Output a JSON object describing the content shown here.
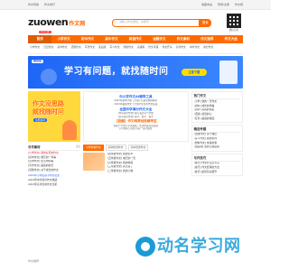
{
  "topbar": {
    "left": [
      "作文导航",
      "作文排行"
    ],
    "right": [
      "收藏本站",
      "登录/注册",
      "作文网"
    ]
  },
  "header": {
    "logo_en": "zuowen",
    "logo_cn": "作文网",
    "search_placeholder": "请输入作文题目、关键字",
    "search_button": "搜索",
    "qr_caption": "微信扫码"
  },
  "nav": {
    "hot_badge": "作文大赛",
    "items": [
      "首页",
      "小学作文",
      "初中作文",
      "高中作文",
      "英语作文",
      "话题作文",
      "作文素材",
      "作文指导",
      "作文大全"
    ]
  },
  "subnav": [
    "小学作文",
    "日记作文",
    "初中作文",
    "话题作文",
    "写景作文",
    "读后感",
    "写人作文",
    "想象作文",
    "演讲稿",
    "作文评语",
    "作文开头",
    "高考作文",
    "中考作文",
    "满分作文"
  ],
  "banner": {
    "tag": "题拍拍",
    "slogan": "学习有问题，就找随时问",
    "cta": "立即下载"
  },
  "poster": {
    "line1": "作文没思路",
    "line2": "就找随时问",
    "button": "免费提问"
  },
  "left_block": {
    "title": "写作素材",
    "more": "更多",
    "items": [
      "[小学作文] 我的好朋友作文",
      "[初中作文] 难忘的一件事",
      "[高中作文] 生活中的美",
      "[写景作文] 美丽的秋天",
      "[话题作文] 关于成长的作文"
    ],
    "items2": [
      "2023年小学生春节作文范文",
      "2023年中考满分作文精选",
      "2023年高考优秀作文赏析"
    ]
  },
  "mid_card": {
    "h1": "中小学作文AI辅导工具",
    "p1": [
      "2023年秋季学期 | 全国千名语文教师推荐",
      "2023年暑假作文 | 全国学生优秀作文征集"
    ],
    "h2": "全国中学满分作文大全",
    "p2": [
      "[中考满分作文] 我与春天有个约会",
      "[高考满分作文] 本手、妙手、俗手"
    ],
    "h3": "【投稿】作文网原创投稿专区",
    "p3": [
      "欢迎广大中小学生投稿，优秀作品可获奖励",
      "[写作技巧] 如何写好一篇记叙文"
    ]
  },
  "mid_tabs": [
    "小学优秀作文",
    "初中优秀作文",
    "高中优秀作文"
  ],
  "mid_rows": [
    "[四年级作文] 我的家乡",
    "[五年级作文] 难忘的一天",
    "[六年级作文] 我的妈妈",
    "[三年级作文] 春天来了",
    "[二年级作文] 我的小狗"
  ],
  "right_block1": {
    "title": "热门作文",
    "items": [
      "[小学] 我的一天作文",
      "[初中] 成长的烦恼",
      "[高中] 青春的色彩",
      "[话题] 感恩的心",
      "[写景] 美丽的校园"
    ]
  },
  "right_block2": {
    "title": "精选专题",
    "items": [
      "[话题作文] 关于诚信",
      "[写人作文] 我的老师",
      "[想象作文] 未来的我",
      "[读后感] 西游记读后感"
    ]
  },
  "right_block3": {
    "title": "写作技巧",
    "items": [
      "[技巧] 作文开头怎么写",
      "[技巧] 作文结尾的方法",
      "[技巧] 如何写好细节"
    ]
  },
  "watermark": "动名学习网",
  "footer": "作文推荐"
}
